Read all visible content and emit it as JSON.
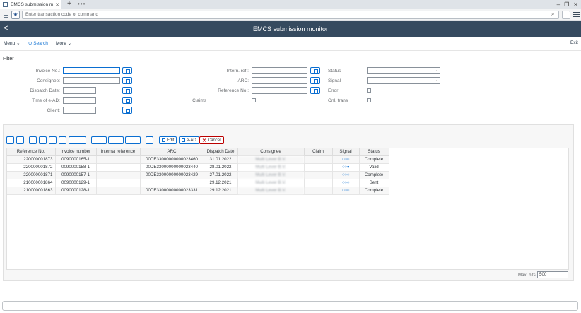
{
  "browser": {
    "tab_title": "EMCS submission m...",
    "tab_close": "✕",
    "new_tab": "+",
    "more_tabs": "•••"
  },
  "command": {
    "placeholder": "Enter transaction code or command"
  },
  "header": {
    "title": "EMCS submission monitor",
    "back": "<"
  },
  "toolbar": {
    "menu": "Menu",
    "search": "Search",
    "more": "More",
    "exit": "Exit"
  },
  "filter": {
    "title": "Filter",
    "invoice_no": "Invoice No.:",
    "consignee": "Consignee:",
    "dispatch_date": "Dispatch Date:",
    "time_ead": "Time of e-AD:",
    "client": "Client:",
    "intern_ref": "Intern. ref.:",
    "arc": "ARC:",
    "reference_no": "Reference No.:",
    "claims": "Claims",
    "status": "Status",
    "signal": "Signal",
    "error": "Error",
    "onl_trans": "Onl. trans"
  },
  "grid_toolbar": {
    "edit": "Edit",
    "ead": "e-AD",
    "cancel": "Cancel"
  },
  "table": {
    "columns": [
      "Reference No.",
      "Invoice number",
      "Internal reference",
      "ARC",
      "Dispatch Date",
      "Consignee",
      "Claim",
      "Signal",
      "Status"
    ],
    "rows": [
      {
        "ref": "220000001873",
        "invoice": "0090000165-1",
        "internal": "",
        "arc": "00DE33000000000023460",
        "date": "31.01.2022",
        "consignee": "Multi Lever B.V.",
        "claim": "",
        "signal": "○○○",
        "status": "Complete"
      },
      {
        "ref": "220000001872",
        "invoice": "0090000158-1",
        "internal": "",
        "arc": "00DE33000000000023440",
        "date": "28.01.2022",
        "consignee": "Multi Lever B.V.",
        "claim": "",
        "signal": "○○●",
        "status": "Valid"
      },
      {
        "ref": "220000001871",
        "invoice": "0090000157-1",
        "internal": "",
        "arc": "00DE33000000000023429",
        "date": "27.01.2022",
        "consignee": "Multi Lever B.V.",
        "claim": "",
        "signal": "○○○",
        "status": "Complete"
      },
      {
        "ref": "210000001864",
        "invoice": "0090000129-1",
        "internal": "",
        "arc": "",
        "date": "29.12.2021",
        "consignee": "Multi Lever B.V.",
        "claim": "",
        "signal": "○○○",
        "status": "Sent"
      },
      {
        "ref": "210000001863",
        "invoice": "0090000128-1",
        "internal": "",
        "arc": "00DE33000000000023331",
        "date": "29.12.2021",
        "consignee": "Multi Lever B.V.",
        "claim": "",
        "signal": "○○○",
        "status": "Complete"
      }
    ]
  },
  "footer": {
    "max_hits_label": "Max. hits:",
    "max_hits_value": "500"
  }
}
